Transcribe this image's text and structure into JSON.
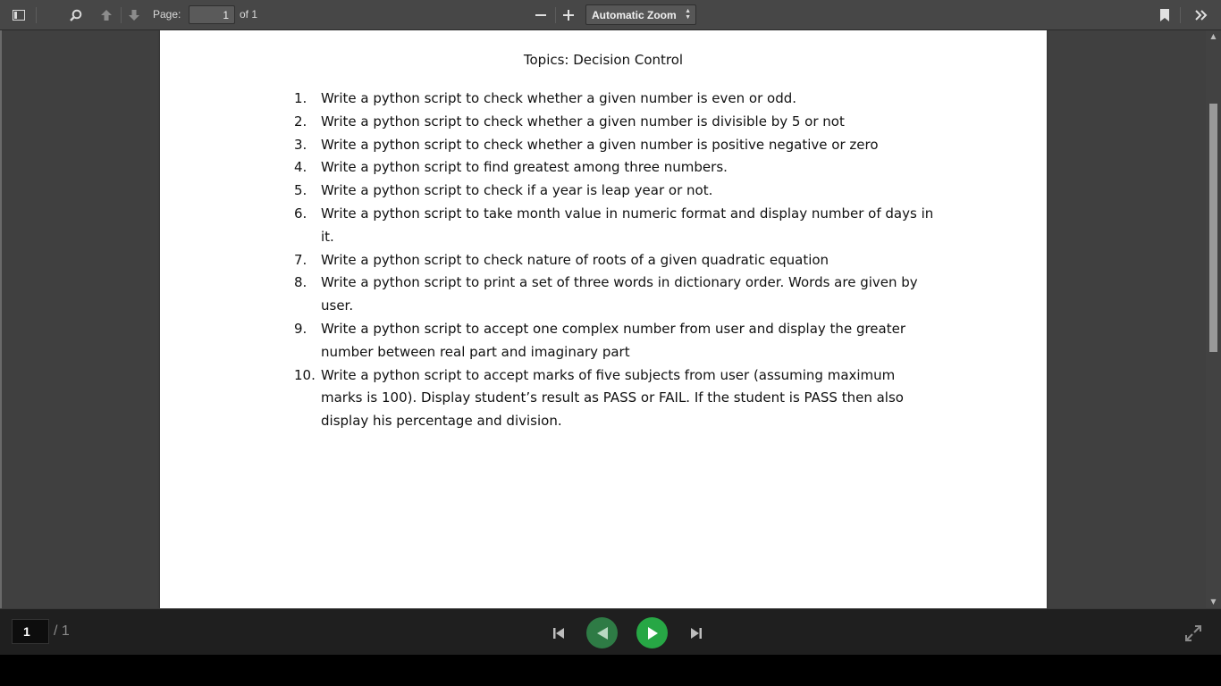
{
  "toolbar": {
    "page_label": "Page:",
    "page_value": "1",
    "page_of": "of 1",
    "zoom_value": "Automatic Zoom",
    "icons": {
      "sidebar": "sidebar-toggle-icon",
      "search": "search-icon",
      "prev": "arrow-up-icon",
      "next": "arrow-down-icon",
      "zoom_out": "minus-icon",
      "zoom_in": "plus-icon",
      "bookmark": "bookmark-icon",
      "tools": "double-chevron-right-icon"
    }
  },
  "document": {
    "title": "Topics: Decision Control",
    "items": [
      {
        "num": "1.",
        "text": "Write a python script to check whether a given number is even or odd."
      },
      {
        "num": "2.",
        "text": "Write a python script to check whether a given number is divisible by 5 or not"
      },
      {
        "num": "3.",
        "text": "Write a python script to check whether a given number is positive negative or zero"
      },
      {
        "num": "4.",
        "text": "Write a python script to find greatest among three numbers."
      },
      {
        "num": "5.",
        "text": "Write a python script to check if a year is leap year or not."
      },
      {
        "num": "6.",
        "text": "Write a python script to take month value in numeric format and display number of days in it."
      },
      {
        "num": "7.",
        "text": "Write a python script to check nature of roots of a given quadratic equation"
      },
      {
        "num": "8.",
        "text": "Write a python script to print a set of three words in dictionary order. Words are given by user."
      },
      {
        "num": "9.",
        "text": "Write a python script to accept one complex number from user and display the greater number between real part and imaginary part"
      },
      {
        "num": "10.",
        "text": "Write a python script to accept marks of five subjects from user (assuming maximum marks is 100). Display student’s result as PASS or FAIL. If the student is PASS then also display his percentage and division."
      }
    ]
  },
  "presentation": {
    "slide_value": "1",
    "slide_total": "/ 1",
    "colors": {
      "prev_button": "#2e7b45",
      "play_button": "#27a745"
    }
  }
}
